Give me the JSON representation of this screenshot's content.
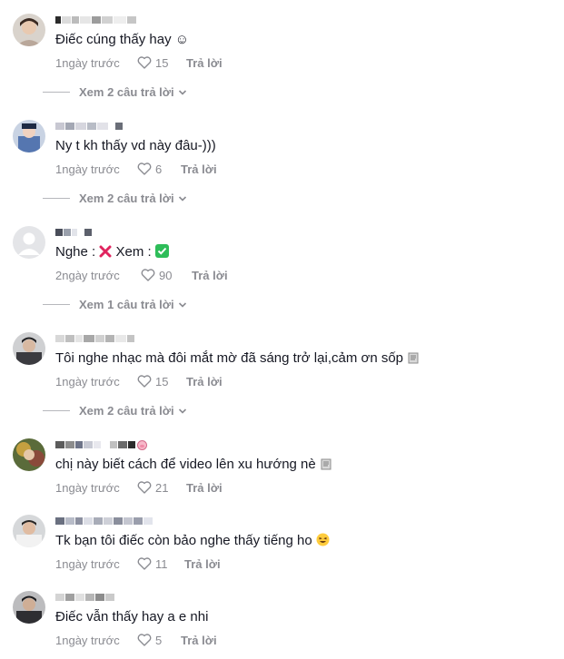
{
  "colors": {
    "text": "#161823",
    "meta": "#8a8b91",
    "heart_outline": "#8a8b91",
    "cross": "#e0245e",
    "check_bg": "#2ebd59"
  },
  "comments": [
    {
      "text": "Điếc cúng thấy hay ☺",
      "time": "1ngày trước",
      "likes": "15",
      "reply_label": "Trả lời",
      "replies_label": "Xem 2 câu trả lời"
    },
    {
      "text": "Ny t kh thấy vd này đâu-)))",
      "time": "1ngày trước",
      "likes": "6",
      "reply_label": "Trả lời",
      "replies_label": "Xem 2 câu trả lời"
    },
    {
      "text_prefix": "Nghe : ",
      "text_middle": " Xem : ",
      "time": "2ngày trước",
      "likes": "90",
      "reply_label": "Trả lời",
      "replies_label": "Xem 1 câu trả lời"
    },
    {
      "text": "Tôi nghe nhạc mà đôi mắt mờ đã sáng trở lại,cảm ơn sốp",
      "time": "1ngày trước",
      "likes": "15",
      "reply_label": "Trả lời",
      "replies_label": "Xem 2 câu trả lời"
    },
    {
      "text": "chị này biết cách để video lên xu hướng nè",
      "time": "1ngày trước",
      "likes": "21",
      "reply_label": "Trả lời"
    },
    {
      "text": "Tk bạn tôi điếc còn bảo nghe thấy tiếng ho",
      "time": "1ngày trước",
      "likes": "11",
      "reply_label": "Trả lời"
    },
    {
      "text": "Điếc vẫn thấy hay a e nhi",
      "time": "1ngày trước",
      "likes": "5",
      "reply_label": "Trả lời"
    }
  ],
  "icons": {
    "like": "heart-outline-icon",
    "expand": "chevron-down-icon",
    "cross": "cross-mark-icon",
    "check": "check-mark-icon",
    "emoji_smile": "smile-emoji-icon",
    "emoji_laugh": "laughing-emoji-icon",
    "emoji_paper": "paper-emoji-icon"
  }
}
